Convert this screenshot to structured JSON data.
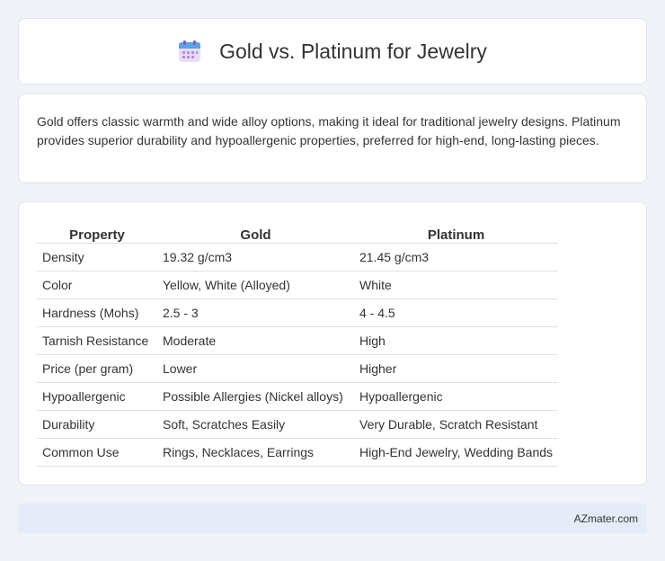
{
  "header": {
    "icon": "calendar-icon",
    "title": "Gold vs. Platinum for Jewelry"
  },
  "intro": {
    "text": "Gold offers classic warmth and wide alloy options, making it ideal for traditional jewelry designs. Platinum provides superior durability and hypoallergenic properties, preferred for high-end, long-lasting pieces."
  },
  "table": {
    "columns": [
      "Property",
      "Gold",
      "Platinum"
    ],
    "rows": [
      [
        "Density",
        "19.32 g/cm3",
        "21.45 g/cm3"
      ],
      [
        "Color",
        "Yellow, White (Alloyed)",
        "White"
      ],
      [
        "Hardness (Mohs)",
        "2.5 - 3",
        "4 - 4.5"
      ],
      [
        "Tarnish Resistance",
        "Moderate",
        "High"
      ],
      [
        "Price (per gram)",
        "Lower",
        "Higher"
      ],
      [
        "Hypoallergenic",
        "Possible Allergies (Nickel alloys)",
        "Hypoallergenic"
      ],
      [
        "Durability",
        "Soft, Scratches Easily",
        "Very Durable, Scratch Resistant"
      ],
      [
        "Common Use",
        "Rings, Necklaces, Earrings",
        "High-End Jewelry, Wedding Bands"
      ]
    ]
  },
  "footer": {
    "brand": "AZmater.com"
  }
}
